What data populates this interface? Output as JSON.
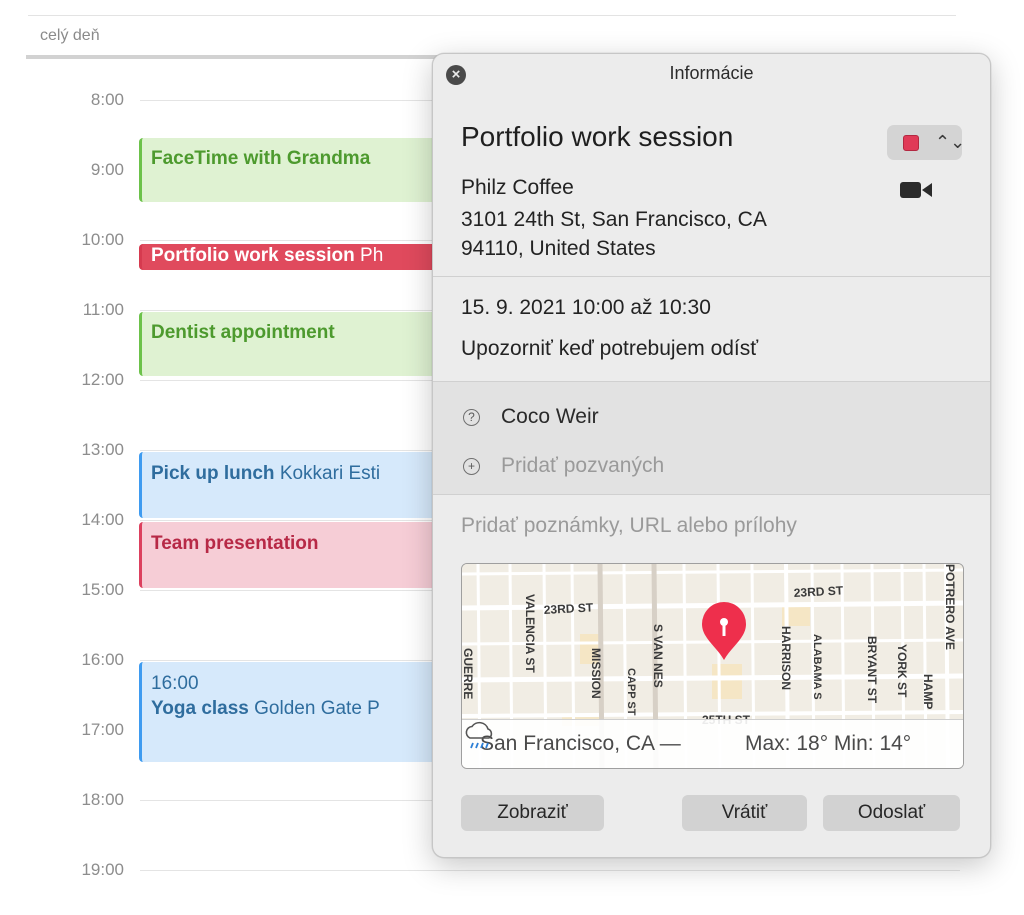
{
  "calendar": {
    "all_day_label": "celý deň",
    "hours": [
      "8:00",
      "9:00",
      "10:00",
      "11:00",
      "12:00",
      "13:00",
      "14:00",
      "15:00",
      "16:00",
      "17:00",
      "18:00",
      "19:00"
    ],
    "events": [
      {
        "title": "FaceTime with Grandma",
        "location": "",
        "time": ""
      },
      {
        "title": "Portfolio work session",
        "location": "Ph",
        "time": ""
      },
      {
        "title": "Dentist appointment",
        "location": "",
        "time": ""
      },
      {
        "title": "Pick up lunch",
        "location": "Kokkari Esti",
        "time": ""
      },
      {
        "title": "Team presentation",
        "location": "",
        "time": ""
      },
      {
        "title": "Yoga class",
        "location": "Golden Gate P",
        "time": "16:00"
      }
    ]
  },
  "popover": {
    "header": "Informácie",
    "close_icon": "close-icon",
    "event_name": "Portfolio work session",
    "calendar_color": "#e03a57",
    "location_name": "Philz Coffee",
    "address_line1": "3101 24th St, San Francisco, CA",
    "address_line2": "94110, United States",
    "date_time": "15. 9. 2021  10:00 až 10:30",
    "alert": "Upozorniť keď potrebujem odísť",
    "invitee": "Coco Weir",
    "add_invitees": "Pridať pozvaných",
    "notes_placeholder": "Pridať poznámky, URL alebo prílohy",
    "map": {
      "streets": [
        "23RD ST",
        "23RD ST",
        "VALENCIA ST",
        "MISSION",
        "CAPP ST",
        "S VAN NES",
        "HARRISON",
        "ALABAMA S",
        "BRYANT ST",
        "YORK ST",
        "HAMP",
        "POTRERO AVE",
        "GUERRE",
        "25TH ST"
      ],
      "weather_city": "San Francisco, CA —",
      "weather_temp": "Max: 18° Min: 14°",
      "weather_icon": "rain-cloud-icon"
    },
    "buttons": {
      "show": "Zobraziť",
      "revert": "Vrátiť",
      "send": "Odoslať"
    }
  }
}
